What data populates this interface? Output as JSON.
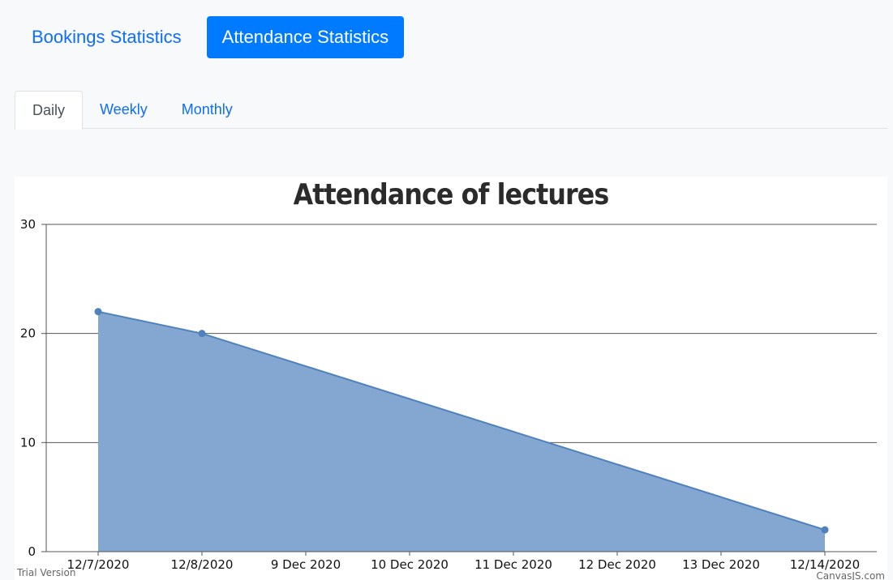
{
  "nav": {
    "items": [
      {
        "label": "Bookings Statistics",
        "active": false
      },
      {
        "label": "Attendance Statistics",
        "active": true
      }
    ]
  },
  "tabs": {
    "items": [
      {
        "label": "Daily",
        "active": true
      },
      {
        "label": "Weekly",
        "active": false
      },
      {
        "label": "Monthly",
        "active": false
      }
    ]
  },
  "colors": {
    "accent": "#007bff",
    "series_fill": "#84a7d2",
    "series_line": "#4f81bc"
  },
  "chart_data": {
    "type": "area",
    "title": "Attendance of lectures",
    "x": [
      "2020-12-07",
      "2020-12-08",
      "2020-12-14"
    ],
    "y": [
      22,
      20,
      2
    ],
    "point_labels": [
      "12/7/2020",
      "12/8/2020",
      "12/14/2020"
    ],
    "x_tick_labels": [
      "12/7/2020",
      "12/8/2020",
      "9 Dec 2020",
      "10 Dec 2020",
      "11 Dec 2020",
      "12 Dec 2020",
      "13 Dec 2020",
      "12/14/2020"
    ],
    "y_ticks": [
      0,
      10,
      20,
      30
    ],
    "ylim": [
      0,
      30
    ],
    "xlim": [
      "2020-12-06 12:00",
      "2020-12-14 12:00"
    ],
    "grid": true,
    "xlabel": "",
    "ylabel": ""
  },
  "watermark": {
    "left": "Trial Version",
    "right": "CanvasJS.com"
  }
}
